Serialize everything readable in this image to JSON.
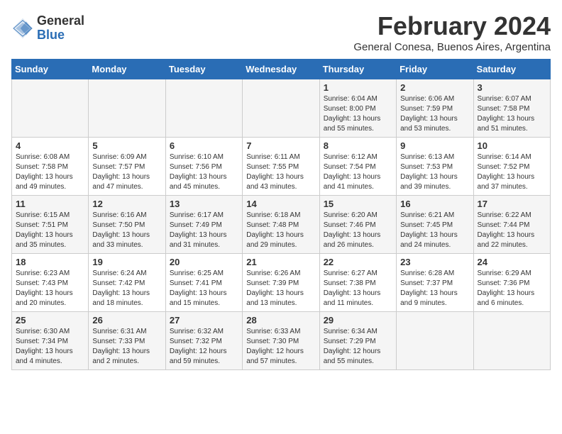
{
  "header": {
    "logo_general": "General",
    "logo_blue": "Blue",
    "month_title": "February 2024",
    "location": "General Conesa, Buenos Aires, Argentina"
  },
  "weekdays": [
    "Sunday",
    "Monday",
    "Tuesday",
    "Wednesday",
    "Thursday",
    "Friday",
    "Saturday"
  ],
  "weeks": [
    [
      {
        "day": "",
        "info": ""
      },
      {
        "day": "",
        "info": ""
      },
      {
        "day": "",
        "info": ""
      },
      {
        "day": "",
        "info": ""
      },
      {
        "day": "1",
        "info": "Sunrise: 6:04 AM\nSunset: 8:00 PM\nDaylight: 13 hours\nand 55 minutes."
      },
      {
        "day": "2",
        "info": "Sunrise: 6:06 AM\nSunset: 7:59 PM\nDaylight: 13 hours\nand 53 minutes."
      },
      {
        "day": "3",
        "info": "Sunrise: 6:07 AM\nSunset: 7:58 PM\nDaylight: 13 hours\nand 51 minutes."
      }
    ],
    [
      {
        "day": "4",
        "info": "Sunrise: 6:08 AM\nSunset: 7:58 PM\nDaylight: 13 hours\nand 49 minutes."
      },
      {
        "day": "5",
        "info": "Sunrise: 6:09 AM\nSunset: 7:57 PM\nDaylight: 13 hours\nand 47 minutes."
      },
      {
        "day": "6",
        "info": "Sunrise: 6:10 AM\nSunset: 7:56 PM\nDaylight: 13 hours\nand 45 minutes."
      },
      {
        "day": "7",
        "info": "Sunrise: 6:11 AM\nSunset: 7:55 PM\nDaylight: 13 hours\nand 43 minutes."
      },
      {
        "day": "8",
        "info": "Sunrise: 6:12 AM\nSunset: 7:54 PM\nDaylight: 13 hours\nand 41 minutes."
      },
      {
        "day": "9",
        "info": "Sunrise: 6:13 AM\nSunset: 7:53 PM\nDaylight: 13 hours\nand 39 minutes."
      },
      {
        "day": "10",
        "info": "Sunrise: 6:14 AM\nSunset: 7:52 PM\nDaylight: 13 hours\nand 37 minutes."
      }
    ],
    [
      {
        "day": "11",
        "info": "Sunrise: 6:15 AM\nSunset: 7:51 PM\nDaylight: 13 hours\nand 35 minutes."
      },
      {
        "day": "12",
        "info": "Sunrise: 6:16 AM\nSunset: 7:50 PM\nDaylight: 13 hours\nand 33 minutes."
      },
      {
        "day": "13",
        "info": "Sunrise: 6:17 AM\nSunset: 7:49 PM\nDaylight: 13 hours\nand 31 minutes."
      },
      {
        "day": "14",
        "info": "Sunrise: 6:18 AM\nSunset: 7:48 PM\nDaylight: 13 hours\nand 29 minutes."
      },
      {
        "day": "15",
        "info": "Sunrise: 6:20 AM\nSunset: 7:46 PM\nDaylight: 13 hours\nand 26 minutes."
      },
      {
        "day": "16",
        "info": "Sunrise: 6:21 AM\nSunset: 7:45 PM\nDaylight: 13 hours\nand 24 minutes."
      },
      {
        "day": "17",
        "info": "Sunrise: 6:22 AM\nSunset: 7:44 PM\nDaylight: 13 hours\nand 22 minutes."
      }
    ],
    [
      {
        "day": "18",
        "info": "Sunrise: 6:23 AM\nSunset: 7:43 PM\nDaylight: 13 hours\nand 20 minutes."
      },
      {
        "day": "19",
        "info": "Sunrise: 6:24 AM\nSunset: 7:42 PM\nDaylight: 13 hours\nand 18 minutes."
      },
      {
        "day": "20",
        "info": "Sunrise: 6:25 AM\nSunset: 7:41 PM\nDaylight: 13 hours\nand 15 minutes."
      },
      {
        "day": "21",
        "info": "Sunrise: 6:26 AM\nSunset: 7:39 PM\nDaylight: 13 hours\nand 13 minutes."
      },
      {
        "day": "22",
        "info": "Sunrise: 6:27 AM\nSunset: 7:38 PM\nDaylight: 13 hours\nand 11 minutes."
      },
      {
        "day": "23",
        "info": "Sunrise: 6:28 AM\nSunset: 7:37 PM\nDaylight: 13 hours\nand 9 minutes."
      },
      {
        "day": "24",
        "info": "Sunrise: 6:29 AM\nSunset: 7:36 PM\nDaylight: 13 hours\nand 6 minutes."
      }
    ],
    [
      {
        "day": "25",
        "info": "Sunrise: 6:30 AM\nSunset: 7:34 PM\nDaylight: 13 hours\nand 4 minutes."
      },
      {
        "day": "26",
        "info": "Sunrise: 6:31 AM\nSunset: 7:33 PM\nDaylight: 13 hours\nand 2 minutes."
      },
      {
        "day": "27",
        "info": "Sunrise: 6:32 AM\nSunset: 7:32 PM\nDaylight: 12 hours\nand 59 minutes."
      },
      {
        "day": "28",
        "info": "Sunrise: 6:33 AM\nSunset: 7:30 PM\nDaylight: 12 hours\nand 57 minutes."
      },
      {
        "day": "29",
        "info": "Sunrise: 6:34 AM\nSunset: 7:29 PM\nDaylight: 12 hours\nand 55 minutes."
      },
      {
        "day": "",
        "info": ""
      },
      {
        "day": "",
        "info": ""
      }
    ]
  ]
}
